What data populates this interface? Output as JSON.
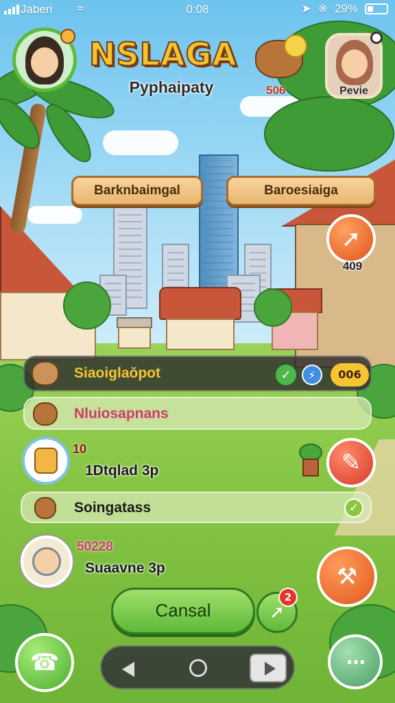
{
  "status_bar": {
    "carrier": "Jaberi",
    "time": "0:08",
    "battery": "29%",
    "battery_level": 0.29
  },
  "header": {
    "title": "NSLAGA",
    "subtitle": "Pyphaipaty",
    "currency_value": "506",
    "profile_name": "Pevie",
    "colors": {
      "title_fill": "#f1c232",
      "title_outline": "#7a3c0f",
      "accent_orange": "#e86a2a",
      "accent_green": "#5fb93a"
    }
  },
  "location_buttons": [
    "Barknbaimgal",
    "Baroesiaiga"
  ],
  "quest_badge": {
    "count": "409"
  },
  "list": {
    "rows": [
      {
        "label": "Siaoiglaŏpot",
        "badge": "006"
      },
      {
        "label": "Nluiosapnans"
      },
      {
        "count": "10",
        "label": "1Dtqlad 3p"
      },
      {
        "label": "Soingatass"
      },
      {
        "count": "50228",
        "label": "Suaavne 3p"
      }
    ]
  },
  "actions": {
    "cancel_label": "Cansal",
    "notification_count": "2"
  },
  "icons": {
    "top_left_avatar": "girl-avatar-icon",
    "currency": "coin-critter-icon",
    "profile": "girl-profile-icon",
    "quest": "arrow-quest-icon",
    "edit": "pencil-icon",
    "hammer": "hammer-icon",
    "phone": "phone-icon",
    "menu": "grid-menu-icon"
  }
}
